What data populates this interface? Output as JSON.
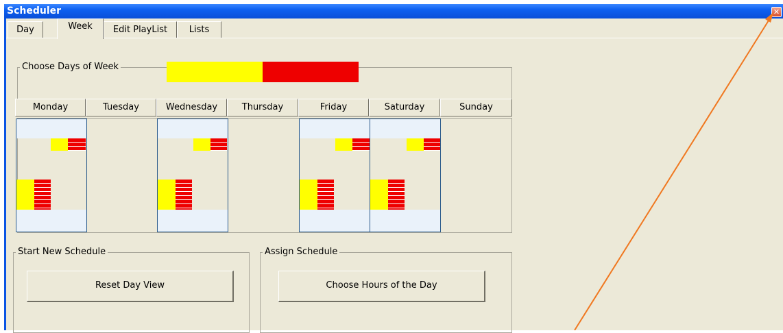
{
  "window": {
    "title": "Scheduler"
  },
  "tabs": [
    {
      "label": "Day",
      "active": false
    },
    {
      "label": "Week",
      "active": true
    },
    {
      "label": "Edit PlayList",
      "active": false
    },
    {
      "label": "Lists",
      "active": false
    }
  ],
  "choose_days": {
    "legend": "Choose Days of Week"
  },
  "days": [
    {
      "label": "Monday",
      "selected": true
    },
    {
      "label": "Tuesday",
      "selected": false
    },
    {
      "label": "Wednesday",
      "selected": true
    },
    {
      "label": "Thursday",
      "selected": false
    },
    {
      "label": "Friday",
      "selected": true
    },
    {
      "label": "Saturday",
      "selected": true
    },
    {
      "label": "Sunday",
      "selected": false
    }
  ],
  "start_new": {
    "legend": "Start New Schedule",
    "button": "Reset Day View"
  },
  "assign": {
    "legend": "Assign Schedule",
    "button": "Choose Hours of the Day"
  },
  "colors": {
    "yellow": "#FFFF00",
    "red": "#EE0000",
    "arrow": "#F07820"
  }
}
